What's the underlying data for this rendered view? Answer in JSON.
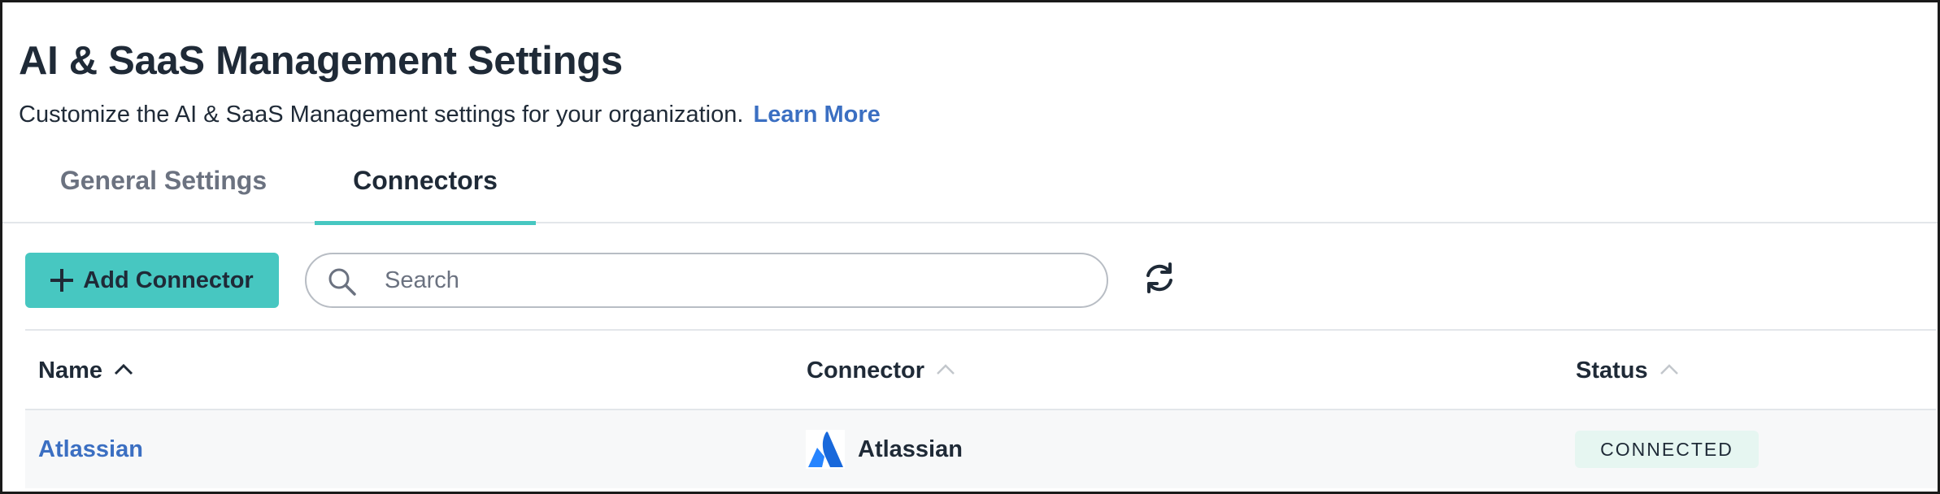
{
  "header": {
    "title": "AI & SaaS Management Settings",
    "description": "Customize the AI & SaaS Management settings for your organization.",
    "learn_more": "Learn More"
  },
  "tabs": [
    {
      "label": "General Settings",
      "active": false
    },
    {
      "label": "Connectors",
      "active": true
    }
  ],
  "toolbar": {
    "add_connector_label": "Add Connector",
    "search_placeholder": "Search",
    "refresh_icon": "refresh-icon"
  },
  "table": {
    "columns": [
      {
        "label": "Name",
        "sort": "ascending"
      },
      {
        "label": "Connector",
        "sort": "none"
      },
      {
        "label": "Status",
        "sort": "none"
      }
    ],
    "rows": [
      {
        "name": "Atlassian",
        "connector": "Atlassian",
        "connector_icon": "atlassian-logo-icon",
        "status": "CONNECTED"
      }
    ]
  },
  "colors": {
    "accent": "#47c7c1",
    "link": "#3b6fc2",
    "text": "#1f2a37",
    "status_connected_bg": "#e6f6f1",
    "atlassian_blue": "#2684ff"
  }
}
